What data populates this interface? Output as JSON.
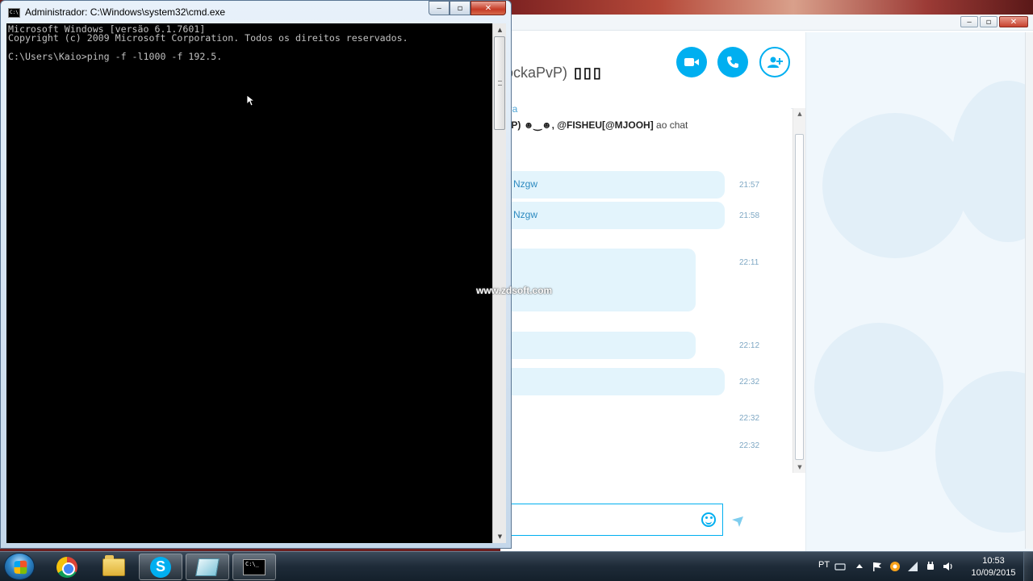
{
  "cmd": {
    "title": "Administrador: C:\\Windows\\system32\\cmd.exe",
    "lines": [
      "Microsoft Windows [versão 6.1.7601]",
      "Copyright (c) 2009 Microsoft Corporation. Todos os direitos reservados.",
      "",
      "C:\\Users\\Kaio>ping -f -l1000 -f 192.5."
    ],
    "controls": {
      "minimize": "‒",
      "maximize": "▫",
      "close": "✕"
    }
  },
  "skype": {
    "contact_name": "ockaPvP)",
    "contact_flag": "▯▯▯",
    "system_link": "ira",
    "system_text_left": "ɐvP)",
    "system_text_mid": "☻‿☻,",
    "system_text_handle": "@FISHEU[@MJOOH]",
    "system_text_tail": "ao chat",
    "messages": [
      {
        "text": "Nzgw",
        "time": "21:57"
      },
      {
        "text": "Nzgw",
        "time": "21:58"
      },
      {
        "text": "",
        "time": "22:11"
      },
      {
        "text": "",
        "time": "22:12"
      },
      {
        "text": "",
        "time": "22:32"
      },
      {
        "text": "",
        "time": "22:32"
      },
      {
        "text": "",
        "time": "22:32"
      }
    ],
    "accent_color": "#00aff0"
  },
  "watermark": "www.zdsoft.com",
  "taskbar": {
    "language": "PT",
    "time": "10:53",
    "date": "10/09/2015",
    "cmd_icon_text": "C:\\_"
  }
}
